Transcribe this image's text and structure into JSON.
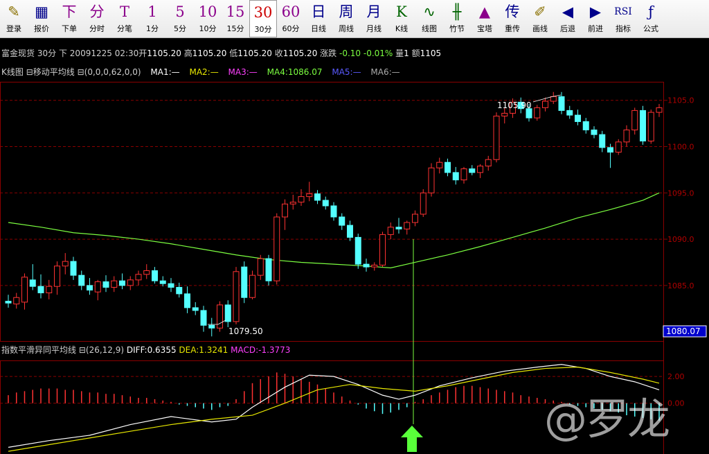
{
  "toolbar": {
    "items": [
      {
        "icon": "✎",
        "label": "登录",
        "color": "#8a7000",
        "name": "login-button"
      },
      {
        "icon": "▦",
        "label": "报价",
        "color": "#00008b",
        "name": "quote-button"
      },
      {
        "icon": "下",
        "label": "下单",
        "color": "#8b008b",
        "name": "order-button"
      },
      {
        "icon": "分",
        "label": "分时",
        "color": "#8b008b",
        "name": "timeshare-button"
      },
      {
        "icon": "T",
        "label": "分笔",
        "color": "#8b008b",
        "name": "tick-button"
      },
      {
        "icon": "1",
        "label": "1分",
        "color": "#8b008b",
        "name": "period-1min-button"
      },
      {
        "icon": "5",
        "label": "5分",
        "color": "#8b008b",
        "name": "period-5min-button"
      },
      {
        "icon": "10",
        "label": "10分",
        "color": "#8b008b",
        "name": "period-10min-button"
      },
      {
        "icon": "15",
        "label": "15分",
        "color": "#8b008b",
        "name": "period-15min-button"
      },
      {
        "icon": "30",
        "label": "30分",
        "color": "#cc0000",
        "name": "period-30min-button",
        "active": true
      },
      {
        "icon": "60",
        "label": "60分",
        "color": "#8b008b",
        "name": "period-60min-button"
      },
      {
        "icon": "日",
        "label": "日线",
        "color": "#00008b",
        "name": "daily-button"
      },
      {
        "icon": "周",
        "label": "周线",
        "color": "#00008b",
        "name": "weekly-button"
      },
      {
        "icon": "月",
        "label": "月线",
        "color": "#00008b",
        "name": "monthly-button"
      },
      {
        "icon": "K",
        "label": "K线",
        "color": "#006400",
        "name": "kline-button"
      },
      {
        "icon": "∿",
        "label": "线图",
        "color": "#006400",
        "name": "line-chart-button"
      },
      {
        "icon": "╫",
        "label": "竹节",
        "color": "#006400",
        "name": "bamboo-button"
      },
      {
        "icon": "▲",
        "label": "宝塔",
        "color": "#8b008b",
        "name": "tower-button"
      },
      {
        "icon": "传",
        "label": "重传",
        "color": "#00008b",
        "name": "reload-button"
      },
      {
        "icon": "✐",
        "label": "画线",
        "color": "#8a7000",
        "name": "draw-line-button"
      },
      {
        "icon": "◀",
        "label": "后退",
        "color": "#00008b",
        "name": "back-button"
      },
      {
        "icon": "▶",
        "label": "前进",
        "color": "#00008b",
        "name": "forward-button"
      },
      {
        "icon": "RSI",
        "label": "指标",
        "color": "#00008b",
        "name": "indicator-button"
      },
      {
        "icon": "ƒ",
        "label": "公式",
        "color": "#00008b",
        "name": "formula-button"
      }
    ]
  },
  "info_bar": {
    "symbol": "富金现货",
    "period": "30分",
    "dir": "下",
    "datetime": "20091225 02:30",
    "open_label": "开",
    "open": "1105.20",
    "high_label": "高",
    "high": "1105.20",
    "low_label": "低",
    "low": "1105.20",
    "close_label": "收",
    "close": "1105.20",
    "change_label": "涨跌",
    "change": "-0.10 -0.01%",
    "volume_label": "量",
    "volume": "1",
    "amount_label": "额",
    "amount": "1105"
  },
  "ma_bar": {
    "panel": "K线图",
    "indicator": "移动平均线",
    "params": "(0,0,0,62,0,0)",
    "ma1": "MA1:—",
    "ma2": "MA2:—",
    "ma3": "MA3:—",
    "ma4": "MA4:1086.07",
    "ma5": "MA5:—",
    "ma6": "MA6:—"
  },
  "macd_bar": {
    "indicator": "指数平滑异同平均线",
    "params": "(26,12,9)",
    "diff": "DIFF:0.6355",
    "dea": "DEA:1.3241",
    "macd": "MACD:-1.3773"
  },
  "colors": {
    "up": "#ff3232",
    "down": "#54ffff",
    "ma4": "#7cff40",
    "diff": "#ffffff",
    "dea": "#e8e800",
    "grid": "#8b0000",
    "crosshair": "#7cff40",
    "arrow": "#59ff3a"
  },
  "price_axis": {
    "labels": [
      "1105.0",
      "1100.0",
      "1095.0",
      "1090.0",
      "1085.0"
    ],
    "current": "1080.07"
  },
  "macd_axis": {
    "labels": [
      "2.00",
      "0.00"
    ]
  },
  "annotations": {
    "high_mark": "1105.90",
    "low_mark": "1079.50"
  },
  "watermark": "@罗龙",
  "chart_data": {
    "type": "candlestick",
    "price_range": [
      1079,
      1107
    ],
    "candles": [
      {
        "o": 1083.3,
        "h": 1084.0,
        "l": 1082.6,
        "c": 1083.1
      },
      {
        "o": 1083.0,
        "h": 1084.2,
        "l": 1082.5,
        "c": 1083.7
      },
      {
        "o": 1083.2,
        "h": 1086.3,
        "l": 1082.4,
        "c": 1085.9
      },
      {
        "o": 1085.6,
        "h": 1087.3,
        "l": 1084.5,
        "c": 1084.9
      },
      {
        "o": 1084.9,
        "h": 1086.2,
        "l": 1083.6,
        "c": 1084.2
      },
      {
        "o": 1084.2,
        "h": 1085.6,
        "l": 1083.5,
        "c": 1084.9
      },
      {
        "o": 1084.9,
        "h": 1087.6,
        "l": 1084.0,
        "c": 1087.1
      },
      {
        "o": 1087.1,
        "h": 1088.5,
        "l": 1086.2,
        "c": 1087.6
      },
      {
        "o": 1087.6,
        "h": 1088.1,
        "l": 1085.6,
        "c": 1086.1
      },
      {
        "o": 1086.1,
        "h": 1086.6,
        "l": 1084.5,
        "c": 1085.0
      },
      {
        "o": 1085.0,
        "h": 1085.8,
        "l": 1084.0,
        "c": 1084.5
      },
      {
        "o": 1084.3,
        "h": 1085.6,
        "l": 1083.4,
        "c": 1085.4
      },
      {
        "o": 1085.4,
        "h": 1086.1,
        "l": 1084.3,
        "c": 1084.8
      },
      {
        "o": 1084.8,
        "h": 1086.0,
        "l": 1084.3,
        "c": 1085.5
      },
      {
        "o": 1085.5,
        "h": 1086.3,
        "l": 1084.6,
        "c": 1085.0
      },
      {
        "o": 1085.0,
        "h": 1086.0,
        "l": 1084.5,
        "c": 1085.6
      },
      {
        "o": 1085.6,
        "h": 1086.6,
        "l": 1085.0,
        "c": 1086.2
      },
      {
        "o": 1086.2,
        "h": 1087.3,
        "l": 1085.7,
        "c": 1086.6
      },
      {
        "o": 1086.6,
        "h": 1087.0,
        "l": 1085.2,
        "c": 1085.5
      },
      {
        "o": 1085.5,
        "h": 1086.0,
        "l": 1084.9,
        "c": 1085.2
      },
      {
        "o": 1085.2,
        "h": 1085.8,
        "l": 1084.3,
        "c": 1084.8
      },
      {
        "o": 1084.8,
        "h": 1085.3,
        "l": 1083.7,
        "c": 1084.1
      },
      {
        "o": 1084.1,
        "h": 1084.9,
        "l": 1082.0,
        "c": 1082.6
      },
      {
        "o": 1082.6,
        "h": 1083.2,
        "l": 1081.8,
        "c": 1082.3
      },
      {
        "o": 1082.3,
        "h": 1082.8,
        "l": 1080.0,
        "c": 1080.7
      },
      {
        "o": 1080.7,
        "h": 1081.5,
        "l": 1079.5,
        "c": 1080.4
      },
      {
        "o": 1080.4,
        "h": 1083.3,
        "l": 1080.0,
        "c": 1082.9
      },
      {
        "o": 1082.9,
        "h": 1083.4,
        "l": 1080.5,
        "c": 1081.1
      },
      {
        "o": 1081.1,
        "h": 1087.0,
        "l": 1080.8,
        "c": 1086.5
      },
      {
        "o": 1087.0,
        "h": 1087.6,
        "l": 1083.1,
        "c": 1083.7
      },
      {
        "o": 1083.7,
        "h": 1086.6,
        "l": 1083.5,
        "c": 1086.1
      },
      {
        "o": 1086.1,
        "h": 1088.3,
        "l": 1085.6,
        "c": 1087.9
      },
      {
        "o": 1087.9,
        "h": 1088.3,
        "l": 1085.0,
        "c": 1085.5
      },
      {
        "o": 1085.5,
        "h": 1092.8,
        "l": 1085.1,
        "c": 1092.4
      },
      {
        "o": 1092.4,
        "h": 1094.3,
        "l": 1091.0,
        "c": 1093.8
      },
      {
        "o": 1093.8,
        "h": 1094.8,
        "l": 1093.2,
        "c": 1094.0
      },
      {
        "o": 1094.0,
        "h": 1095.4,
        "l": 1093.6,
        "c": 1094.6
      },
      {
        "o": 1094.6,
        "h": 1096.2,
        "l": 1094.1,
        "c": 1094.9
      },
      {
        "o": 1094.9,
        "h": 1095.3,
        "l": 1093.8,
        "c": 1094.2
      },
      {
        "o": 1094.2,
        "h": 1094.6,
        "l": 1093.2,
        "c": 1093.6
      },
      {
        "o": 1093.6,
        "h": 1094.0,
        "l": 1092.0,
        "c": 1092.4
      },
      {
        "o": 1092.4,
        "h": 1092.8,
        "l": 1091.0,
        "c": 1091.5
      },
      {
        "o": 1091.5,
        "h": 1092.0,
        "l": 1089.8,
        "c": 1090.2
      },
      {
        "o": 1090.2,
        "h": 1090.6,
        "l": 1086.8,
        "c": 1087.3
      },
      {
        "o": 1087.3,
        "h": 1087.9,
        "l": 1086.5,
        "c": 1087.0
      },
      {
        "o": 1087.0,
        "h": 1087.5,
        "l": 1086.6,
        "c": 1087.2
      },
      {
        "o": 1087.2,
        "h": 1090.8,
        "l": 1087.0,
        "c": 1090.5
      },
      {
        "o": 1090.5,
        "h": 1091.8,
        "l": 1090.0,
        "c": 1091.3
      },
      {
        "o": 1091.3,
        "h": 1092.3,
        "l": 1090.6,
        "c": 1091.1
      },
      {
        "o": 1091.1,
        "h": 1092.0,
        "l": 1090.5,
        "c": 1091.8
      },
      {
        "o": 1091.8,
        "h": 1093.1,
        "l": 1091.4,
        "c": 1092.7
      },
      {
        "o": 1092.7,
        "h": 1095.4,
        "l": 1092.4,
        "c": 1095.0
      },
      {
        "o": 1095.0,
        "h": 1098.2,
        "l": 1094.6,
        "c": 1097.7
      },
      {
        "o": 1097.7,
        "h": 1098.8,
        "l": 1097.1,
        "c": 1098.3
      },
      {
        "o": 1098.3,
        "h": 1098.7,
        "l": 1096.8,
        "c": 1097.2
      },
      {
        "o": 1097.2,
        "h": 1097.8,
        "l": 1095.9,
        "c": 1096.4
      },
      {
        "o": 1096.4,
        "h": 1097.8,
        "l": 1096.0,
        "c": 1097.6
      },
      {
        "o": 1097.6,
        "h": 1098.0,
        "l": 1096.9,
        "c": 1097.2
      },
      {
        "o": 1097.2,
        "h": 1098.1,
        "l": 1096.6,
        "c": 1097.9
      },
      {
        "o": 1097.9,
        "h": 1099.0,
        "l": 1097.4,
        "c": 1098.6
      },
      {
        "o": 1098.6,
        "h": 1103.7,
        "l": 1098.3,
        "c": 1103.3
      },
      {
        "o": 1103.3,
        "h": 1104.2,
        "l": 1102.5,
        "c": 1103.6
      },
      {
        "o": 1103.6,
        "h": 1105.2,
        "l": 1103.1,
        "c": 1104.8
      },
      {
        "o": 1104.8,
        "h": 1105.3,
        "l": 1103.6,
        "c": 1104.1
      },
      {
        "o": 1104.1,
        "h": 1104.6,
        "l": 1102.7,
        "c": 1103.1
      },
      {
        "o": 1103.1,
        "h": 1104.5,
        "l": 1102.8,
        "c": 1104.2
      },
      {
        "o": 1104.2,
        "h": 1105.3,
        "l": 1103.8,
        "c": 1104.9
      },
      {
        "o": 1104.9,
        "h": 1105.9,
        "l": 1104.6,
        "c": 1105.4
      },
      {
        "o": 1105.4,
        "h": 1105.9,
        "l": 1103.5,
        "c": 1103.9
      },
      {
        "o": 1103.9,
        "h": 1104.4,
        "l": 1103.0,
        "c": 1103.4
      },
      {
        "o": 1103.4,
        "h": 1104.0,
        "l": 1102.3,
        "c": 1102.7
      },
      {
        "o": 1102.7,
        "h": 1103.1,
        "l": 1101.4,
        "c": 1101.8
      },
      {
        "o": 1101.8,
        "h": 1102.2,
        "l": 1100.9,
        "c": 1101.3
      },
      {
        "o": 1101.3,
        "h": 1101.7,
        "l": 1099.4,
        "c": 1099.9
      },
      {
        "o": 1099.9,
        "h": 1100.3,
        "l": 1097.7,
        "c": 1099.4
      },
      {
        "o": 1099.4,
        "h": 1100.8,
        "l": 1099.1,
        "c": 1100.5
      },
      {
        "o": 1100.5,
        "h": 1102.3,
        "l": 1100.0,
        "c": 1101.8
      },
      {
        "o": 1101.8,
        "h": 1104.2,
        "l": 1101.3,
        "c": 1103.9
      },
      {
        "o": 1103.9,
        "h": 1104.4,
        "l": 1100.2,
        "c": 1100.6
      },
      {
        "o": 1100.6,
        "h": 1104.0,
        "l": 1100.3,
        "c": 1103.7
      },
      {
        "o": 1103.7,
        "h": 1104.6,
        "l": 1103.2,
        "c": 1104.2
      }
    ],
    "ma4": [
      [
        0,
        1091.8
      ],
      [
        4,
        1091.3
      ],
      [
        8,
        1090.7
      ],
      [
        12,
        1090.4
      ],
      [
        16,
        1090.0
      ],
      [
        20,
        1089.5
      ],
      [
        24,
        1088.9
      ],
      [
        28,
        1088.3
      ],
      [
        32,
        1087.8
      ],
      [
        36,
        1087.5
      ],
      [
        40,
        1087.3
      ],
      [
        44,
        1087.1
      ],
      [
        47,
        1086.9
      ],
      [
        50,
        1087.5
      ],
      [
        54,
        1088.3
      ],
      [
        58,
        1089.2
      ],
      [
        62,
        1090.2
      ],
      [
        66,
        1091.2
      ],
      [
        70,
        1092.3
      ],
      [
        74,
        1093.2
      ],
      [
        78,
        1094.2
      ],
      [
        80,
        1095.0
      ]
    ],
    "macd_range": [
      -3.8,
      3.2
    ],
    "diff": [
      [
        0,
        -3.3
      ],
      [
        5,
        -2.8
      ],
      [
        10,
        -2.4
      ],
      [
        15,
        -1.6
      ],
      [
        20,
        -1.0
      ],
      [
        25,
        -1.4
      ],
      [
        28,
        -1.2
      ],
      [
        30,
        -0.3
      ],
      [
        34,
        1.2
      ],
      [
        37,
        2.1
      ],
      [
        40,
        2.0
      ],
      [
        43,
        1.4
      ],
      [
        46,
        0.6
      ],
      [
        48,
        0.3
      ],
      [
        50,
        0.6
      ],
      [
        53,
        1.3
      ],
      [
        57,
        1.9
      ],
      [
        61,
        2.4
      ],
      [
        65,
        2.7
      ],
      [
        68,
        2.9
      ],
      [
        71,
        2.6
      ],
      [
        74,
        2.0
      ],
      [
        77,
        1.6
      ],
      [
        80,
        1.0
      ]
    ],
    "dea": [
      [
        0,
        -3.6
      ],
      [
        5,
        -3.1
      ],
      [
        10,
        -2.6
      ],
      [
        15,
        -2.1
      ],
      [
        20,
        -1.6
      ],
      [
        25,
        -1.2
      ],
      [
        30,
        -0.9
      ],
      [
        34,
        0.0
      ],
      [
        38,
        1.0
      ],
      [
        42,
        1.4
      ],
      [
        46,
        1.1
      ],
      [
        50,
        0.9
      ],
      [
        54,
        1.3
      ],
      [
        58,
        1.8
      ],
      [
        62,
        2.3
      ],
      [
        66,
        2.6
      ],
      [
        70,
        2.7
      ],
      [
        74,
        2.3
      ],
      [
        78,
        1.8
      ],
      [
        80,
        1.5
      ]
    ],
    "hist": [
      0.6,
      0.8,
      0.9,
      1.0,
      1.1,
      1.1,
      1.1,
      1.0,
      1.0,
      0.9,
      0.8,
      0.8,
      0.7,
      0.7,
      0.6,
      0.5,
      0.4,
      0.4,
      0.3,
      0.2,
      0.1,
      -0.1,
      -0.2,
      -0.3,
      -0.4,
      -0.5,
      -0.3,
      -0.2,
      0.3,
      0.9,
      1.5,
      1.8,
      2.0,
      2.3,
      2.2,
      2.0,
      1.8,
      1.6,
      1.4,
      1.1,
      0.8,
      0.5,
      0.2,
      -0.1,
      -0.4,
      -0.6,
      -0.8,
      -0.7,
      -0.5,
      -0.3,
      0.1,
      0.3,
      0.6,
      0.8,
      1.0,
      1.2,
      1.3,
      1.3,
      1.2,
      1.1,
      1.0,
      0.9,
      0.8,
      0.6,
      0.5,
      0.4,
      0.3,
      0.2,
      0.1,
      -0.1,
      -0.2,
      -0.3,
      -0.4,
      -0.5,
      -0.6,
      -0.7,
      -0.9,
      -1.0,
      -1.1,
      -1.2,
      -1.3
    ]
  }
}
